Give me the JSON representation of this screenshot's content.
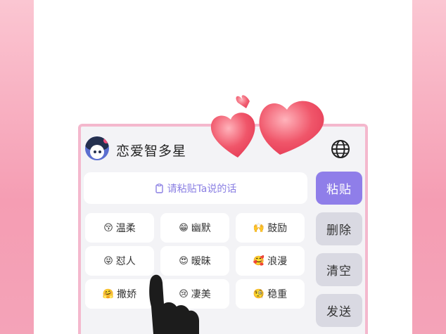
{
  "app": {
    "title": "恋爱智多星"
  },
  "icons": {
    "avatar": "cartoon-avatar-icon",
    "globe": "globe-icon",
    "clipboard": "clipboard-icon"
  },
  "input": {
    "placeholder": "请粘贴Ta说的话"
  },
  "actions": {
    "paste": "粘贴",
    "delete": "删除",
    "clear": "清空",
    "send": "发送"
  },
  "tones": [
    {
      "emoji": "😚",
      "label": "温柔"
    },
    {
      "emoji": "😁",
      "label": "幽默"
    },
    {
      "emoji": "🙌",
      "label": "鼓励"
    },
    {
      "emoji": "😝",
      "label": "怼人"
    },
    {
      "emoji": "😍",
      "label": "暧昧"
    },
    {
      "emoji": "🥰",
      "label": "浪漫"
    },
    {
      "emoji": "🤗",
      "label": "撒娇"
    },
    {
      "emoji": "😢",
      "label": "凄美"
    },
    {
      "emoji": "🧐",
      "label": "稳重"
    }
  ],
  "colors": {
    "accent": "#8f7ee9",
    "frame": "#f4b8cd",
    "background": "#f3f3f6",
    "heart": "#f0566a"
  }
}
